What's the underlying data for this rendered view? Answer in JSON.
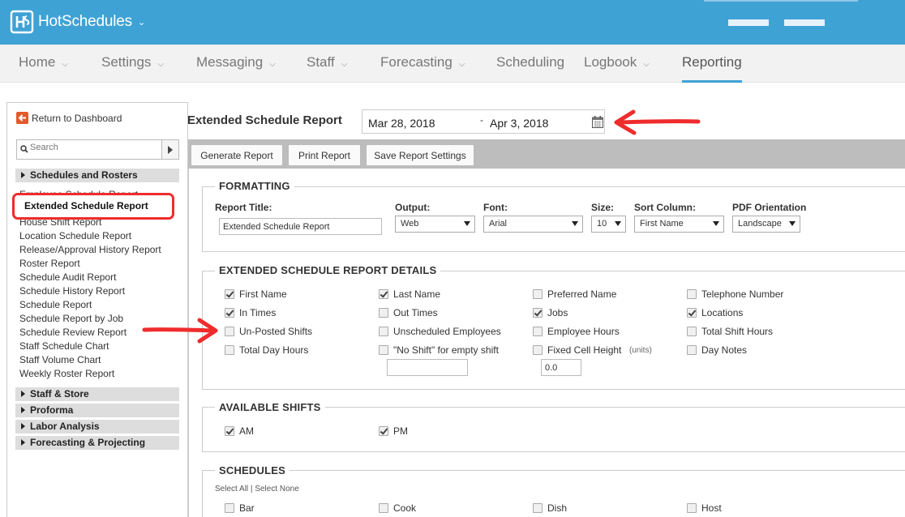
{
  "app": {
    "name": "HotSchedules"
  },
  "nav": [
    "Home",
    "Settings",
    "Messaging",
    "Staff",
    "Forecasting",
    "Scheduling",
    "Logbook",
    "Reporting"
  ],
  "nav_has_caret": [
    true,
    true,
    true,
    true,
    true,
    false,
    true,
    false
  ],
  "sidebar": {
    "return_label": "Return to Dashboard",
    "search_placeholder": "Search",
    "sections": [
      "Schedules and Rosters",
      "Staff & Store",
      "Proforma",
      "Labor Analysis",
      "Forecasting & Projecting"
    ],
    "partial_top": "Employee Schedule Report",
    "highlighted": "Extended Schedule Report",
    "partial_bottom": "House Shift Report",
    "items": [
      "Location Schedule Report",
      "Release/Approval History Report",
      "Roster Report",
      "Schedule Audit Report",
      "Schedule History Report",
      "Schedule Report",
      "Schedule Report by Job",
      "Schedule Review Report",
      "Staff Schedule Chart",
      "Staff Volume Chart",
      "Weekly Roster Report"
    ]
  },
  "header": {
    "title": "Extended Schedule Report",
    "date_start": "Mar 28, 2018",
    "date_sep": "-",
    "date_end": "Apr 3, 2018"
  },
  "toolbar": {
    "generate": "Generate Report",
    "print": "Print Report",
    "save": "Save Report Settings"
  },
  "formatting": {
    "legend": "FORMATTING",
    "report_title_label": "Report Title:",
    "report_title_value": "Extended Schedule Report",
    "output_label": "Output:",
    "output_value": "Web",
    "font_label": "Font:",
    "font_value": "Arial",
    "size_label": "Size:",
    "size_value": "10",
    "sort_label": "Sort Column:",
    "sort_value": "First Name",
    "pdf_label": "PDF Orientation",
    "pdf_value": "Landscape"
  },
  "details": {
    "legend": "EXTENDED SCHEDULE REPORT DETAILS",
    "options": [
      {
        "label": "First Name",
        "checked": true
      },
      {
        "label": "Last Name",
        "checked": true
      },
      {
        "label": "Preferred Name",
        "checked": false
      },
      {
        "label": "Telephone Number",
        "checked": false
      },
      {
        "label": "In Times",
        "checked": true
      },
      {
        "label": "Out Times",
        "checked": false
      },
      {
        "label": "Jobs",
        "checked": true
      },
      {
        "label": "Locations",
        "checked": true
      },
      {
        "label": "Un-Posted Shifts",
        "checked": false
      },
      {
        "label": "Unscheduled Employees",
        "checked": false
      },
      {
        "label": "Employee Hours",
        "checked": false
      },
      {
        "label": "Total Shift Hours",
        "checked": false
      },
      {
        "label": "Total Day Hours",
        "checked": false
      },
      {
        "label": "\"No Shift\" for empty shift",
        "checked": false
      },
      {
        "label": "Fixed Cell Height",
        "checked": false
      },
      {
        "label": "Day Notes",
        "checked": false
      }
    ],
    "units_label": "(units)",
    "no_shift_value": "",
    "cell_height_value": "0.0"
  },
  "shifts": {
    "legend": "AVAILABLE SHIFTS",
    "options": [
      {
        "label": "AM",
        "checked": true
      },
      {
        "label": "PM",
        "checked": true
      }
    ]
  },
  "schedules": {
    "legend": "SCHEDULES",
    "select_all": "Select All",
    "divider": "|",
    "select_none": "Select None",
    "options": [
      {
        "label": "Bar",
        "checked": false
      },
      {
        "label": "Cook",
        "checked": false
      },
      {
        "label": "Dish",
        "checked": false
      },
      {
        "label": "Host",
        "checked": false
      }
    ]
  },
  "colors": {
    "brand": "#3fa2d5",
    "annotation": "#ef2c2c"
  }
}
